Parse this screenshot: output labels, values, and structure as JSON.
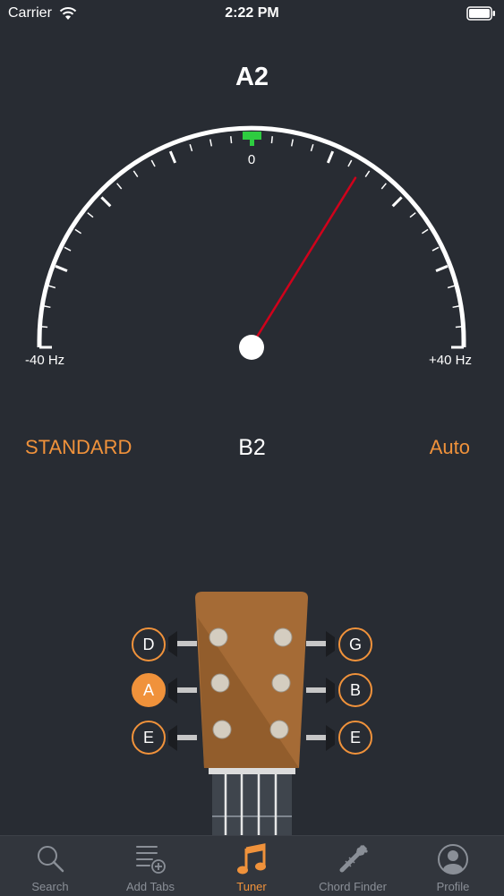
{
  "status_bar": {
    "carrier": "Carrier",
    "time": "2:22 PM"
  },
  "tuner": {
    "detected_note": "A2",
    "scale_zero": "0",
    "scale_min": "-40 Hz",
    "scale_max": "+40 Hz",
    "needle_value_hz": 14,
    "tuning": "STANDARD",
    "target_note": "B2",
    "mode": "Auto"
  },
  "strings": {
    "left": [
      "D",
      "A",
      "E"
    ],
    "right": [
      "G",
      "B",
      "E"
    ],
    "active": "A"
  },
  "tab_bar": {
    "items": [
      {
        "label": "Search",
        "icon": "search-icon"
      },
      {
        "label": "Add Tabs",
        "icon": "add-tabs-icon"
      },
      {
        "label": "Tuner",
        "icon": "music-note-icon"
      },
      {
        "label": "Chord Finder",
        "icon": "guitar-icon"
      },
      {
        "label": "Profile",
        "icon": "profile-icon"
      }
    ],
    "active": "Tuner"
  },
  "colors": {
    "background": "#282c33",
    "accent": "#f0923b",
    "needle": "#d0021b",
    "in_tune": "#2ecc40"
  }
}
